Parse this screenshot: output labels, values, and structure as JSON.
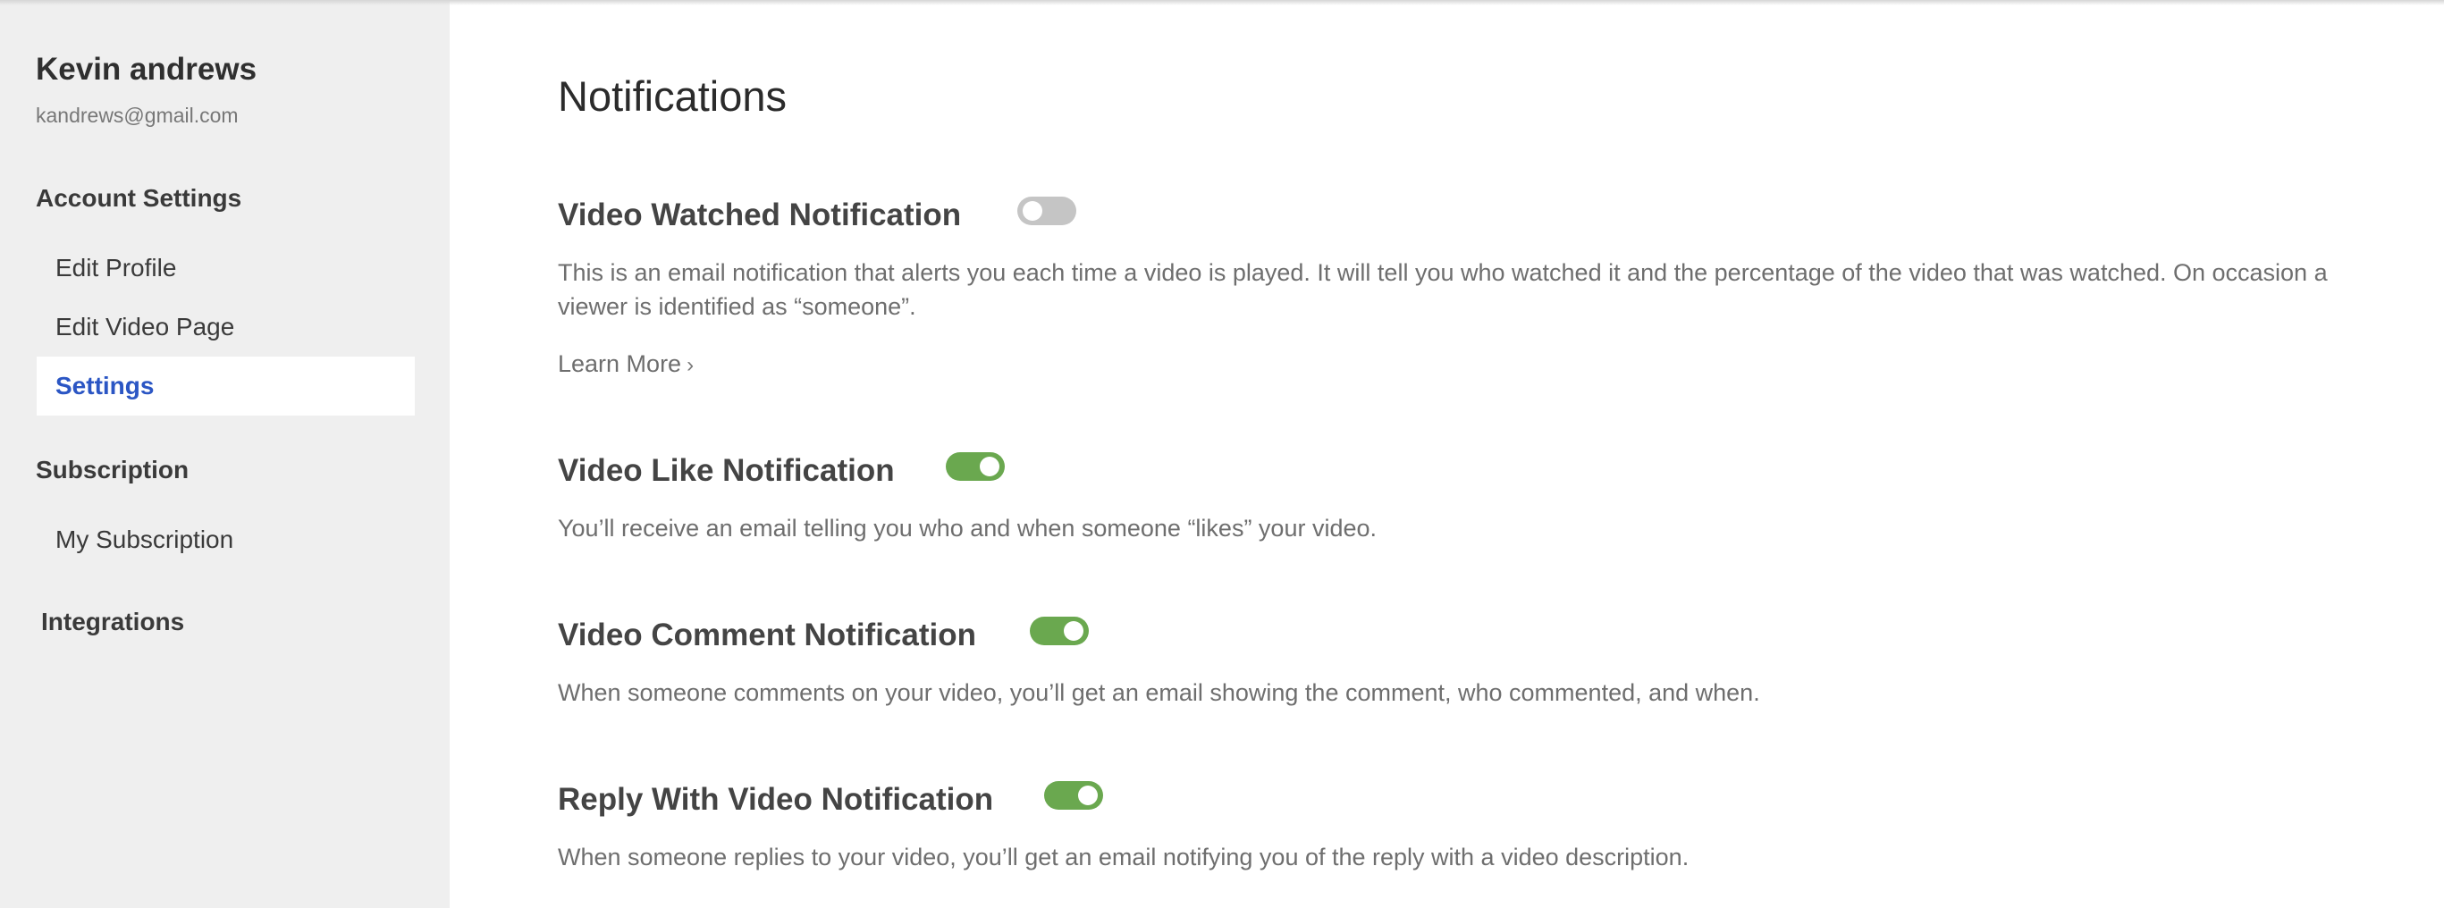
{
  "user": {
    "name": "Kevin andrews",
    "email": "kandrews@gmail.com"
  },
  "sidebar": {
    "sections": [
      {
        "heading": "Account Settings",
        "items": [
          {
            "label": "Edit Profile",
            "active": false
          },
          {
            "label": "Edit Video Page",
            "active": false
          },
          {
            "label": "Settings",
            "active": true
          }
        ]
      },
      {
        "heading": "Subscription",
        "items": [
          {
            "label": "My Subscription",
            "active": false
          }
        ]
      },
      {
        "heading": "Integrations",
        "items": []
      }
    ]
  },
  "main": {
    "title": "Notifications",
    "notifications": [
      {
        "title": "Video Watched Notification",
        "enabled": false,
        "description": "This is an email notification that alerts you each time a video is played. It will tell you who watched it and the percentage of the video that was watched. On occasion a viewer is identified as “someone”.",
        "link": "Learn More"
      },
      {
        "title": "Video Like Notification",
        "enabled": true,
        "description": "You’ll receive an email telling you who and when someone “likes” your video."
      },
      {
        "title": "Video Comment Notification",
        "enabled": true,
        "description": "When someone comments on your video, you’ll get an email showing the comment, who commented, and when."
      },
      {
        "title": "Reply With Video Notification",
        "enabled": true,
        "description": "When someone replies to your video, you’ll get an email notifying you of the reply with a video description."
      }
    ]
  },
  "colors": {
    "sidebar_bg": "#efefef",
    "active_link": "#2b56c4",
    "toggle_on": "#6aa84f",
    "toggle_off": "#c5c5c5"
  },
  "icons": {
    "learn_more_chevron": "chevron-right-icon"
  }
}
